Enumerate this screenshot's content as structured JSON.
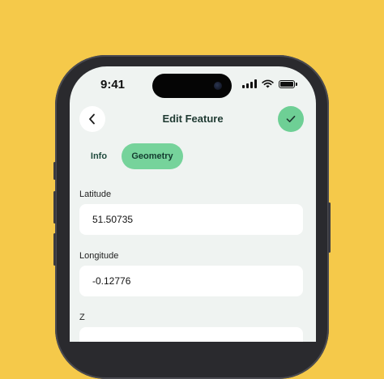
{
  "status_bar": {
    "time": "9:41",
    "icons": [
      "signal-icon",
      "wifi-icon",
      "battery-icon"
    ]
  },
  "header": {
    "title": "Edit Feature",
    "back_icon": "chevron-left-icon",
    "confirm_icon": "check-icon"
  },
  "tabs": [
    {
      "label": "Info",
      "active": false
    },
    {
      "label": "Geometry",
      "active": true
    }
  ],
  "fields": {
    "latitude": {
      "label": "Latitude",
      "value": "51.50735"
    },
    "longitude": {
      "label": "Longitude",
      "value": "-0.12776"
    },
    "z": {
      "label": "Z"
    }
  },
  "colors": {
    "background": "#f5c94a",
    "screen": "#eff3f1",
    "accent": "#6ecf95",
    "title_text": "#1f3a32"
  }
}
